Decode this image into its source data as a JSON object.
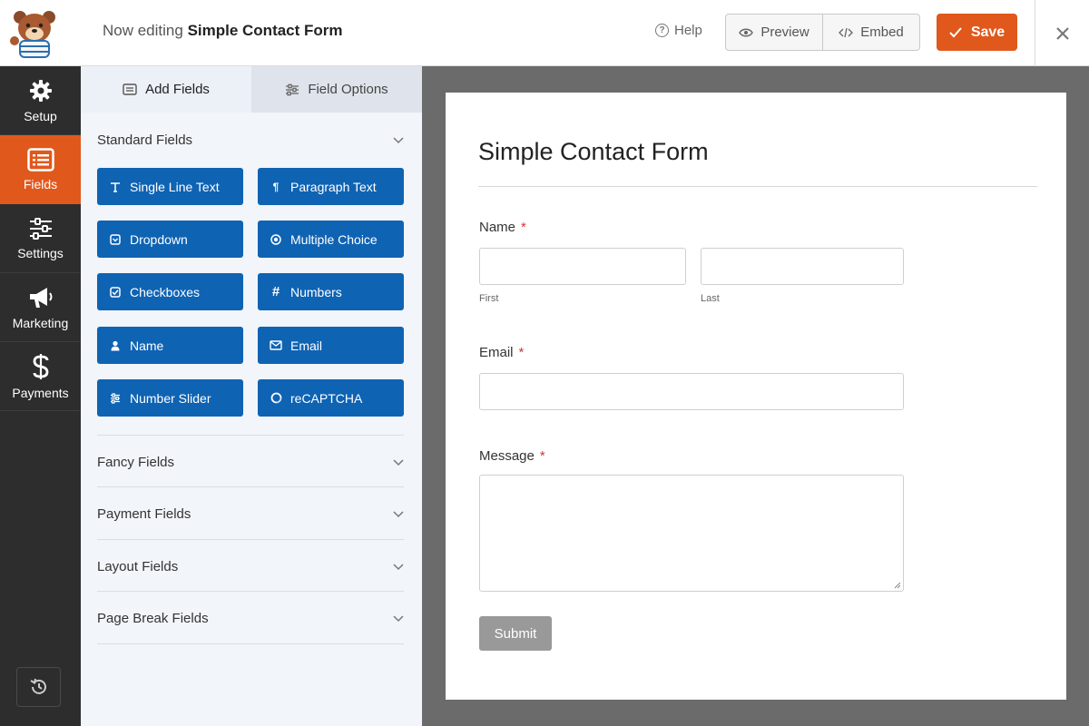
{
  "header": {
    "editing_prefix": "Now editing",
    "form_name": "Simple Contact Form",
    "help_label": "Help",
    "preview_label": "Preview",
    "embed_label": "Embed",
    "save_label": "Save"
  },
  "sidebar": {
    "items": [
      {
        "label": "Setup",
        "icon": "gear-icon"
      },
      {
        "label": "Fields",
        "icon": "fields-list-icon",
        "active": true
      },
      {
        "label": "Settings",
        "icon": "sliders-icon"
      },
      {
        "label": "Marketing",
        "icon": "megaphone-icon"
      },
      {
        "label": "Payments",
        "icon": "dollar-icon"
      }
    ]
  },
  "panel": {
    "tabs": [
      {
        "label": "Add Fields",
        "icon": "list-icon"
      },
      {
        "label": "Field Options",
        "icon": "sliders-icon"
      }
    ],
    "standard_title": "Standard Fields",
    "standard_fields": [
      {
        "label": "Single Line Text",
        "icon": "T"
      },
      {
        "label": "Paragraph Text",
        "icon": "¶"
      },
      {
        "label": "Dropdown",
        "icon": "▾"
      },
      {
        "label": "Multiple Choice",
        "icon": "◉"
      },
      {
        "label": "Checkboxes",
        "icon": "☑"
      },
      {
        "label": "Numbers",
        "icon": "#"
      },
      {
        "label": "Name",
        "icon": "person"
      },
      {
        "label": "Email",
        "icon": "envelope"
      },
      {
        "label": "Number Slider",
        "icon": "sliders"
      },
      {
        "label": "reCAPTCHA",
        "icon": "recaptcha"
      }
    ],
    "collapsed_sections": [
      "Fancy Fields",
      "Payment Fields",
      "Layout Fields",
      "Page Break Fields"
    ]
  },
  "form": {
    "title": "Simple Contact Form",
    "name_label": "Name",
    "first_sublabel": "First",
    "last_sublabel": "Last",
    "email_label": "Email",
    "message_label": "Message",
    "required_mark": "*",
    "submit_label": "Submit"
  },
  "colors": {
    "accent": "#e1581c",
    "field_button": "#0f63b3",
    "nav_bg": "#2d2d2d",
    "canvas_bg": "#6b6b6b"
  }
}
